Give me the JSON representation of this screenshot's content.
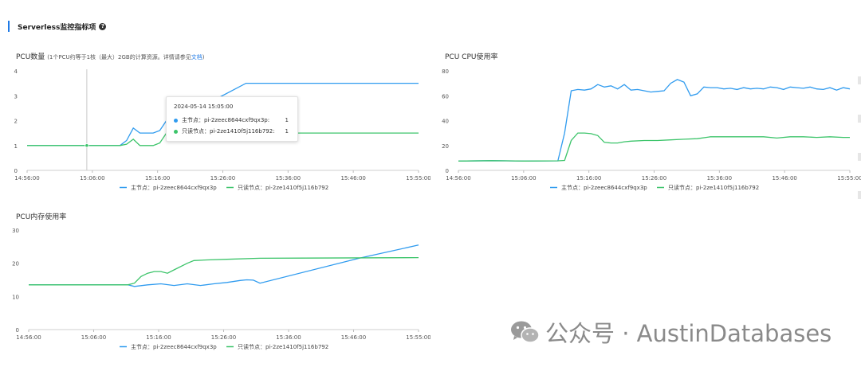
{
  "section": {
    "title": "Serverless监控指标项",
    "help_glyph": "?"
  },
  "charts_meta": [
    {
      "title": "PCU数量",
      "note": "(1个PCU约等于1核（最大）2GB的计算资源。详情请参见",
      "link": "文档",
      "note_end": ")"
    },
    {
      "title": "PCU CPU使用率",
      "note": "",
      "link": "",
      "note_end": ""
    },
    {
      "title": "PCU内存使用率",
      "note": "",
      "link": "",
      "note_end": ""
    }
  ],
  "tooltip": {
    "time": "2024-05-14 15:05:00",
    "rows": [
      {
        "label": "主节点：pi-2zeec8644cxf9qx3p:",
        "value": "1",
        "color": "#2f9bef"
      },
      {
        "label": "只读节点：pi-2ze1410f5j116b792:",
        "value": "1",
        "color": "#3cc46a"
      }
    ]
  },
  "watermark": {
    "text": "公众号 · AustinDatabases",
    "icon": "wechat-icon"
  },
  "chart_data": [
    {
      "type": "line",
      "title": "PCU数量",
      "x_ticks": [
        "14:56:00",
        "15:06:00",
        "15:16:00",
        "15:26:00",
        "15:36:00",
        "15:46:00",
        "15:55:00"
      ],
      "y_ticks": [
        0,
        1,
        2,
        3,
        4
      ],
      "ylim": [
        0,
        4
      ],
      "x_range_min": [
        0,
        59
      ],
      "legend_position": "bottom",
      "series": [
        {
          "name": "主节点：pi-2zeec8644cxf9qx3p",
          "color": "#2f9bef",
          "points": [
            [
              0,
              1
            ],
            [
              14,
              1
            ],
            [
              15,
              1.2
            ],
            [
              16,
              1.7
            ],
            [
              17,
              1.5
            ],
            [
              19,
              1.5
            ],
            [
              20,
              1.6
            ],
            [
              21,
              2
            ],
            [
              22,
              2.05
            ],
            [
              28,
              2.8
            ],
            [
              33,
              3.5
            ],
            [
              59,
              3.5
            ]
          ]
        },
        {
          "name": "只读节点：pi-2ze1410f5j116b792",
          "color": "#3cc46a",
          "points": [
            [
              0,
              1
            ],
            [
              14,
              1
            ],
            [
              15,
              1.05
            ],
            [
              16,
              1.25
            ],
            [
              17,
              1
            ],
            [
              19,
              1
            ],
            [
              20,
              1.1
            ],
            [
              21,
              1.5
            ],
            [
              24,
              1.5
            ],
            [
              59,
              1.5
            ]
          ]
        }
      ]
    },
    {
      "type": "line",
      "title": "PCU CPU使用率",
      "x_ticks": [
        "14:56:00",
        "15:06:00",
        "15:16:00",
        "15:26:00",
        "15:36:00",
        "15:46:00",
        "15:55:00"
      ],
      "y_ticks": [
        0,
        20,
        40,
        60,
        80
      ],
      "ylim": [
        0,
        80
      ],
      "x_range_min": [
        0,
        59
      ],
      "legend_position": "bottom",
      "series": [
        {
          "name": "主节点：pi-2zeec8644cxf9qx3p",
          "color": "#2f9bef",
          "points": [
            [
              0,
              7.5
            ],
            [
              5,
              7.8
            ],
            [
              10,
              7.5
            ],
            [
              15,
              7.7
            ],
            [
              16,
              30
            ],
            [
              17,
              64
            ],
            [
              18,
              65
            ],
            [
              19,
              64.5
            ],
            [
              20,
              65.5
            ],
            [
              21,
              69
            ],
            [
              22,
              67
            ],
            [
              23,
              68
            ],
            [
              24,
              65.5
            ],
            [
              25,
              69
            ],
            [
              26,
              64.5
            ],
            [
              27,
              65
            ],
            [
              28,
              64
            ],
            [
              29,
              63
            ],
            [
              30,
              63.5
            ],
            [
              31,
              64
            ],
            [
              32,
              70
            ],
            [
              33,
              73
            ],
            [
              34,
              71
            ],
            [
              35,
              60
            ],
            [
              36,
              61.5
            ],
            [
              37,
              67
            ],
            [
              38,
              66.5
            ],
            [
              39,
              66.5
            ],
            [
              40,
              65.5
            ],
            [
              41,
              66
            ],
            [
              42,
              65
            ],
            [
              43,
              66.5
            ],
            [
              44,
              65.5
            ],
            [
              45,
              66
            ],
            [
              46,
              65.5
            ],
            [
              47,
              67
            ],
            [
              48,
              66.5
            ],
            [
              49,
              65
            ],
            [
              50,
              67
            ],
            [
              51,
              66.5
            ],
            [
              52,
              66
            ],
            [
              53,
              67
            ],
            [
              54,
              65.5
            ],
            [
              55,
              65
            ],
            [
              56,
              66.5
            ],
            [
              57,
              64.5
            ],
            [
              58,
              66.5
            ],
            [
              59,
              65.5
            ]
          ]
        },
        {
          "name": "只读节点：pi-2ze1410f5j116b792",
          "color": "#3cc46a",
          "points": [
            [
              0,
              7.5
            ],
            [
              5,
              7.8
            ],
            [
              10,
              7.5
            ],
            [
              15,
              7.7
            ],
            [
              16,
              8
            ],
            [
              17,
              24
            ],
            [
              18,
              30
            ],
            [
              19,
              30
            ],
            [
              20,
              29.5
            ],
            [
              21,
              28
            ],
            [
              22,
              22.5
            ],
            [
              23,
              22
            ],
            [
              24,
              22
            ],
            [
              25,
              23
            ],
            [
              26,
              23.5
            ],
            [
              28,
              24
            ],
            [
              30,
              24
            ],
            [
              32,
              24.5
            ],
            [
              34,
              25
            ],
            [
              36,
              25.5
            ],
            [
              38,
              27
            ],
            [
              40,
              27
            ],
            [
              42,
              27
            ],
            [
              44,
              27
            ],
            [
              46,
              27
            ],
            [
              48,
              26
            ],
            [
              50,
              27
            ],
            [
              52,
              27
            ],
            [
              54,
              26.5
            ],
            [
              56,
              27
            ],
            [
              58,
              26.5
            ],
            [
              59,
              26.5
            ]
          ]
        }
      ]
    },
    {
      "type": "line",
      "title": "PCU内存使用率",
      "x_ticks": [
        "14:56:00",
        "15:06:00",
        "15:16:00",
        "15:26:00",
        "15:36:00",
        "15:46:00",
        "15:55:00"
      ],
      "y_ticks": [
        0,
        10,
        20,
        30
      ],
      "ylim": [
        0,
        30
      ],
      "x_range_min": [
        0,
        59
      ],
      "legend_position": "bottom",
      "series": [
        {
          "name": "主节点：pi-2zeec8644cxf9qx3p",
          "color": "#2f9bef",
          "points": [
            [
              0,
              13.5
            ],
            [
              15,
              13.5
            ],
            [
              16,
              13
            ],
            [
              18,
              13.5
            ],
            [
              20,
              13.8
            ],
            [
              22,
              13.3
            ],
            [
              24,
              13.8
            ],
            [
              26,
              13.3
            ],
            [
              28,
              13.8
            ],
            [
              30,
              14.2
            ],
            [
              32,
              14.8
            ],
            [
              33,
              15
            ],
            [
              34,
              14.9
            ],
            [
              35,
              14
            ],
            [
              50,
              21.5
            ],
            [
              59,
              25.5
            ]
          ]
        },
        {
          "name": "只读节点：pi-2ze1410f5j116b792",
          "color": "#3cc46a",
          "points": [
            [
              0,
              13.5
            ],
            [
              15,
              13.5
            ],
            [
              16,
              14
            ],
            [
              17,
              16
            ],
            [
              18,
              17
            ],
            [
              19,
              17.5
            ],
            [
              20,
              17.5
            ],
            [
              21,
              17
            ],
            [
              22,
              18
            ],
            [
              24,
              20
            ],
            [
              25,
              20.8
            ],
            [
              27,
              21
            ],
            [
              30,
              21.2
            ],
            [
              35,
              21.5
            ],
            [
              59,
              21.7
            ]
          ]
        }
      ]
    }
  ]
}
